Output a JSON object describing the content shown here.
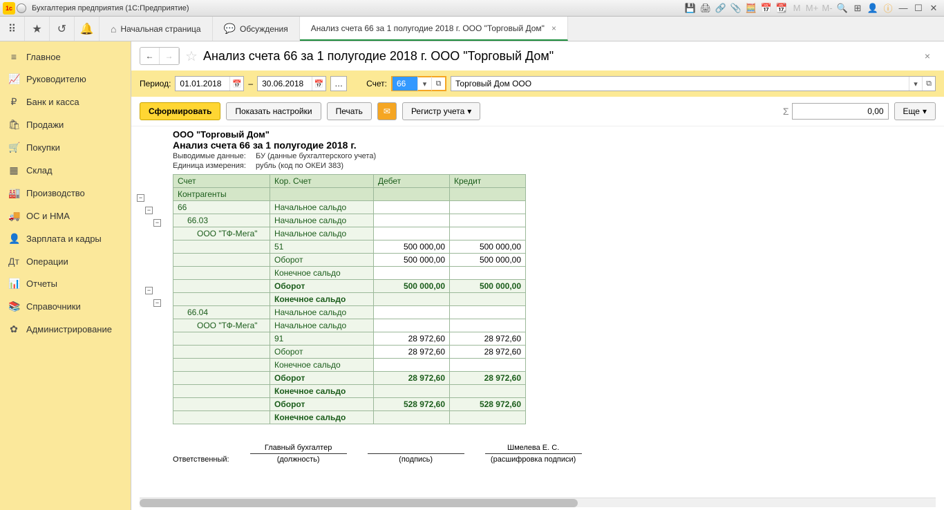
{
  "window": {
    "title": "Бухгалтерия предприятия  (1С:Предприятие)"
  },
  "tabs": {
    "home": "Начальная страница",
    "discuss": "Обсуждения",
    "active": "Анализ счета 66 за 1 полугодие 2018 г. ООО \"Торговый Дом\""
  },
  "sidebar": {
    "items": [
      {
        "icon": "≡",
        "label": "Главное"
      },
      {
        "icon": "📈",
        "label": "Руководителю"
      },
      {
        "icon": "₽",
        "label": "Банк и касса"
      },
      {
        "icon": "🛍",
        "label": "Продажи"
      },
      {
        "icon": "🛒",
        "label": "Покупки"
      },
      {
        "icon": "▦",
        "label": "Склад"
      },
      {
        "icon": "🏭",
        "label": "Производство"
      },
      {
        "icon": "🚚",
        "label": "ОС и НМА"
      },
      {
        "icon": "👤",
        "label": "Зарплата и кадры"
      },
      {
        "icon": "Дт",
        "label": "Операции"
      },
      {
        "icon": "📊",
        "label": "Отчеты"
      },
      {
        "icon": "📚",
        "label": "Справочники"
      },
      {
        "icon": "✿",
        "label": "Администрирование"
      }
    ]
  },
  "page": {
    "title": "Анализ счета 66 за 1 полугодие 2018 г. ООО \"Торговый Дом\""
  },
  "params": {
    "period_label": "Период:",
    "date_from": "01.01.2018",
    "date_to": "30.06.2018",
    "dash": "–",
    "account_label": "Счет:",
    "account": "66",
    "org": "Торговый Дом ООО"
  },
  "toolbar": {
    "generate": "Сформировать",
    "settings": "Показать настройки",
    "print": "Печать",
    "register": "Регистр учета",
    "more": "Еще",
    "sum": "0,00"
  },
  "report": {
    "org": "ООО \"Торговый Дом\"",
    "title": "Анализ счета 66 за 1 полугодие 2018 г.",
    "out_lbl": "Выводимые данные:",
    "out_val": "БУ (данные бухгалтерского учета)",
    "unit_lbl": "Единица измерения:",
    "unit_val": "рубль (код по ОКЕИ 383)",
    "hdr": {
      "c1": "Счет",
      "c1b": "Контрагенты",
      "c2": "Кор. Счет",
      "c3": "Дебет",
      "c4": "Кредит"
    },
    "labels": {
      "start": "Начальное сальдо",
      "oborot": "Оборот",
      "end": "Конечное сальдо"
    },
    "rows": [
      {
        "acct": "66",
        "korr": "Начальное сальдо",
        "d": "",
        "k": ""
      },
      {
        "acct": "66.03",
        "korr": "Начальное сальдо",
        "d": "",
        "k": "",
        "indent": 1
      },
      {
        "acct": "ООО \"ТФ-Мега\"",
        "korr": "Начальное сальдо",
        "d": "",
        "k": "",
        "indent": 2
      },
      {
        "acct": "",
        "korr": "51",
        "d": "500 000,00",
        "k": "500 000,00"
      },
      {
        "acct": "",
        "korr": "Оборот",
        "d": "500 000,00",
        "k": "500 000,00"
      },
      {
        "acct": "",
        "korr": "Конечное сальдо",
        "d": "",
        "k": ""
      },
      {
        "acct": "",
        "korr": "Оборот",
        "d": "500 000,00",
        "k": "500 000,00",
        "bold": true
      },
      {
        "acct": "",
        "korr": "Конечное сальдо",
        "d": "",
        "k": "",
        "bold": true
      },
      {
        "acct": "66.04",
        "korr": "Начальное сальдо",
        "d": "",
        "k": "",
        "indent": 1
      },
      {
        "acct": "ООО \"ТФ-Мега\"",
        "korr": "Начальное сальдо",
        "d": "",
        "k": "",
        "indent": 2
      },
      {
        "acct": "",
        "korr": "91",
        "d": "28 972,60",
        "k": "28 972,60"
      },
      {
        "acct": "",
        "korr": "Оборот",
        "d": "28 972,60",
        "k": "28 972,60"
      },
      {
        "acct": "",
        "korr": "Конечное сальдо",
        "d": "",
        "k": ""
      },
      {
        "acct": "",
        "korr": "Оборот",
        "d": "28 972,60",
        "k": "28 972,60",
        "bold": true
      },
      {
        "acct": "",
        "korr": "Конечное сальдо",
        "d": "",
        "k": "",
        "bold": true
      },
      {
        "acct": "",
        "korr": "Оборот",
        "d": "528 972,60",
        "k": "528 972,60",
        "bold": true
      },
      {
        "acct": "",
        "korr": "Конечное сальдо",
        "d": "",
        "k": "",
        "bold": true
      }
    ],
    "sig": {
      "resp": "Ответственный:",
      "pos": "Главный бухгалтер",
      "pos_lbl": "(должность)",
      "sign_lbl": "(подпись)",
      "name": "Шмелева Е. С.",
      "name_lbl": "(расшифровка подписи)"
    }
  }
}
